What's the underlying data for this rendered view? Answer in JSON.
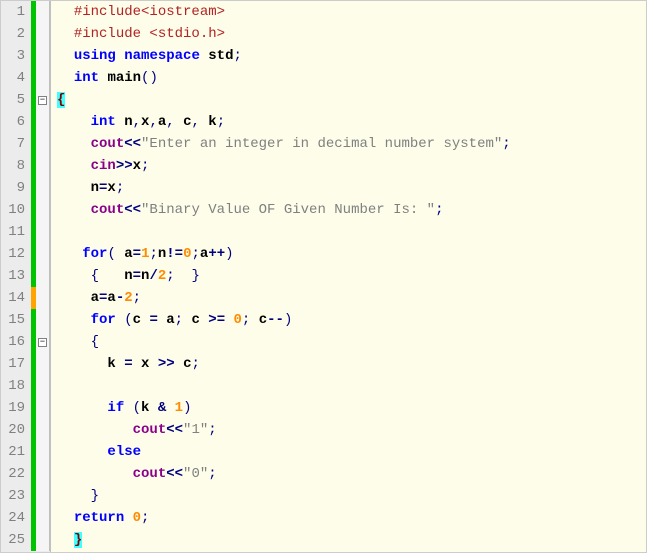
{
  "lines": [
    {
      "num": 1,
      "bar": "green",
      "fold": "",
      "tokens": [
        {
          "cls": "tok-plain",
          "t": "  "
        },
        {
          "cls": "tok-pre",
          "t": "#include<iostream>"
        }
      ]
    },
    {
      "num": 2,
      "bar": "green",
      "fold": "",
      "tokens": [
        {
          "cls": "tok-plain",
          "t": "  "
        },
        {
          "cls": "tok-pre",
          "t": "#include <stdio.h>"
        }
      ]
    },
    {
      "num": 3,
      "bar": "green",
      "fold": "",
      "tokens": [
        {
          "cls": "tok-plain",
          "t": "  "
        },
        {
          "cls": "tok-kw",
          "t": "using"
        },
        {
          "cls": "tok-plain",
          "t": " "
        },
        {
          "cls": "tok-kw",
          "t": "namespace"
        },
        {
          "cls": "tok-plain",
          "t": " "
        },
        {
          "cls": "tok-id",
          "t": "std"
        },
        {
          "cls": "tok-punc",
          "t": ";"
        }
      ]
    },
    {
      "num": 4,
      "bar": "green",
      "fold": "",
      "tokens": [
        {
          "cls": "tok-plain",
          "t": "  "
        },
        {
          "cls": "tok-kw",
          "t": "int"
        },
        {
          "cls": "tok-plain",
          "t": " "
        },
        {
          "cls": "tok-id",
          "t": "main"
        },
        {
          "cls": "tok-punc",
          "t": "()"
        }
      ]
    },
    {
      "num": 5,
      "bar": "green",
      "fold": "box",
      "tokens": [
        {
          "cls": "tok-br-hl",
          "t": "{"
        }
      ]
    },
    {
      "num": 6,
      "bar": "green",
      "fold": "",
      "tokens": [
        {
          "cls": "tok-plain",
          "t": "    "
        },
        {
          "cls": "tok-kw",
          "t": "int"
        },
        {
          "cls": "tok-plain",
          "t": " "
        },
        {
          "cls": "tok-id",
          "t": "n"
        },
        {
          "cls": "tok-punc",
          "t": ","
        },
        {
          "cls": "tok-id",
          "t": "x"
        },
        {
          "cls": "tok-punc",
          "t": ","
        },
        {
          "cls": "tok-id",
          "t": "a"
        },
        {
          "cls": "tok-punc",
          "t": ","
        },
        {
          "cls": "tok-plain",
          "t": " "
        },
        {
          "cls": "tok-id",
          "t": "c"
        },
        {
          "cls": "tok-punc",
          "t": ","
        },
        {
          "cls": "tok-plain",
          "t": " "
        },
        {
          "cls": "tok-id",
          "t": "k"
        },
        {
          "cls": "tok-punc",
          "t": ";"
        }
      ]
    },
    {
      "num": 7,
      "bar": "green",
      "fold": "",
      "tokens": [
        {
          "cls": "tok-plain",
          "t": "    "
        },
        {
          "cls": "tok-type",
          "t": "cout"
        },
        {
          "cls": "tok-op",
          "t": "<<"
        },
        {
          "cls": "tok-str",
          "t": "\"Enter an integer in decimal number system\""
        },
        {
          "cls": "tok-punc",
          "t": ";"
        }
      ]
    },
    {
      "num": 8,
      "bar": "green",
      "fold": "",
      "tokens": [
        {
          "cls": "tok-plain",
          "t": "    "
        },
        {
          "cls": "tok-type",
          "t": "cin"
        },
        {
          "cls": "tok-op",
          "t": ">>"
        },
        {
          "cls": "tok-id",
          "t": "x"
        },
        {
          "cls": "tok-punc",
          "t": ";"
        }
      ]
    },
    {
      "num": 9,
      "bar": "green",
      "fold": "",
      "tokens": [
        {
          "cls": "tok-plain",
          "t": "    "
        },
        {
          "cls": "tok-id",
          "t": "n"
        },
        {
          "cls": "tok-op",
          "t": "="
        },
        {
          "cls": "tok-id",
          "t": "x"
        },
        {
          "cls": "tok-punc",
          "t": ";"
        }
      ]
    },
    {
      "num": 10,
      "bar": "green",
      "fold": "",
      "tokens": [
        {
          "cls": "tok-plain",
          "t": "    "
        },
        {
          "cls": "tok-type",
          "t": "cout"
        },
        {
          "cls": "tok-op",
          "t": "<<"
        },
        {
          "cls": "tok-str",
          "t": "\"Binary Value OF Given Number Is: \""
        },
        {
          "cls": "tok-punc",
          "t": ";"
        }
      ]
    },
    {
      "num": 11,
      "bar": "green",
      "fold": "",
      "tokens": []
    },
    {
      "num": 12,
      "bar": "green",
      "fold": "",
      "tokens": [
        {
          "cls": "tok-plain",
          "t": "   "
        },
        {
          "cls": "tok-kw",
          "t": "for"
        },
        {
          "cls": "tok-punc",
          "t": "("
        },
        {
          "cls": "tok-plain",
          "t": " "
        },
        {
          "cls": "tok-id",
          "t": "a"
        },
        {
          "cls": "tok-op",
          "t": "="
        },
        {
          "cls": "tok-num",
          "t": "1"
        },
        {
          "cls": "tok-punc",
          "t": ";"
        },
        {
          "cls": "tok-id",
          "t": "n"
        },
        {
          "cls": "tok-op",
          "t": "!="
        },
        {
          "cls": "tok-num",
          "t": "0"
        },
        {
          "cls": "tok-punc",
          "t": ";"
        },
        {
          "cls": "tok-id",
          "t": "a"
        },
        {
          "cls": "tok-op",
          "t": "++"
        },
        {
          "cls": "tok-punc",
          "t": ")"
        }
      ]
    },
    {
      "num": 13,
      "bar": "green",
      "fold": "",
      "tokens": [
        {
          "cls": "tok-plain",
          "t": "    "
        },
        {
          "cls": "tok-punc",
          "t": "{"
        },
        {
          "cls": "tok-plain",
          "t": "   "
        },
        {
          "cls": "tok-id",
          "t": "n"
        },
        {
          "cls": "tok-op",
          "t": "="
        },
        {
          "cls": "tok-id",
          "t": "n"
        },
        {
          "cls": "tok-op",
          "t": "/"
        },
        {
          "cls": "tok-num",
          "t": "2"
        },
        {
          "cls": "tok-punc",
          "t": ";"
        },
        {
          "cls": "tok-plain",
          "t": "  "
        },
        {
          "cls": "tok-punc",
          "t": "}"
        }
      ]
    },
    {
      "num": 14,
      "bar": "orange",
      "fold": "",
      "tokens": [
        {
          "cls": "tok-plain",
          "t": "    "
        },
        {
          "cls": "tok-id",
          "t": "a"
        },
        {
          "cls": "tok-op",
          "t": "="
        },
        {
          "cls": "tok-id",
          "t": "a"
        },
        {
          "cls": "tok-op",
          "t": "-"
        },
        {
          "cls": "tok-num",
          "t": "2"
        },
        {
          "cls": "tok-punc",
          "t": ";"
        }
      ]
    },
    {
      "num": 15,
      "bar": "green",
      "fold": "",
      "tokens": [
        {
          "cls": "tok-plain",
          "t": "    "
        },
        {
          "cls": "tok-kw",
          "t": "for"
        },
        {
          "cls": "tok-plain",
          "t": " "
        },
        {
          "cls": "tok-punc",
          "t": "("
        },
        {
          "cls": "tok-id",
          "t": "c"
        },
        {
          "cls": "tok-plain",
          "t": " "
        },
        {
          "cls": "tok-op",
          "t": "="
        },
        {
          "cls": "tok-plain",
          "t": " "
        },
        {
          "cls": "tok-id",
          "t": "a"
        },
        {
          "cls": "tok-punc",
          "t": ";"
        },
        {
          "cls": "tok-plain",
          "t": " "
        },
        {
          "cls": "tok-id",
          "t": "c"
        },
        {
          "cls": "tok-plain",
          "t": " "
        },
        {
          "cls": "tok-op",
          "t": ">="
        },
        {
          "cls": "tok-plain",
          "t": " "
        },
        {
          "cls": "tok-num",
          "t": "0"
        },
        {
          "cls": "tok-punc",
          "t": ";"
        },
        {
          "cls": "tok-plain",
          "t": " "
        },
        {
          "cls": "tok-id",
          "t": "c"
        },
        {
          "cls": "tok-op",
          "t": "--"
        },
        {
          "cls": "tok-punc",
          "t": ")"
        }
      ]
    },
    {
      "num": 16,
      "bar": "green",
      "fold": "box",
      "tokens": [
        {
          "cls": "tok-plain",
          "t": "    "
        },
        {
          "cls": "tok-punc",
          "t": "{"
        }
      ]
    },
    {
      "num": 17,
      "bar": "green",
      "fold": "",
      "tokens": [
        {
          "cls": "tok-plain",
          "t": "      "
        },
        {
          "cls": "tok-id",
          "t": "k"
        },
        {
          "cls": "tok-plain",
          "t": " "
        },
        {
          "cls": "tok-op",
          "t": "="
        },
        {
          "cls": "tok-plain",
          "t": " "
        },
        {
          "cls": "tok-id",
          "t": "x"
        },
        {
          "cls": "tok-plain",
          "t": " "
        },
        {
          "cls": "tok-op",
          "t": ">>"
        },
        {
          "cls": "tok-plain",
          "t": " "
        },
        {
          "cls": "tok-id",
          "t": "c"
        },
        {
          "cls": "tok-punc",
          "t": ";"
        }
      ]
    },
    {
      "num": 18,
      "bar": "green",
      "fold": "",
      "tokens": []
    },
    {
      "num": 19,
      "bar": "green",
      "fold": "",
      "tokens": [
        {
          "cls": "tok-plain",
          "t": "      "
        },
        {
          "cls": "tok-kw",
          "t": "if"
        },
        {
          "cls": "tok-plain",
          "t": " "
        },
        {
          "cls": "tok-punc",
          "t": "("
        },
        {
          "cls": "tok-id",
          "t": "k"
        },
        {
          "cls": "tok-plain",
          "t": " "
        },
        {
          "cls": "tok-op",
          "t": "&"
        },
        {
          "cls": "tok-plain",
          "t": " "
        },
        {
          "cls": "tok-num",
          "t": "1"
        },
        {
          "cls": "tok-punc",
          "t": ")"
        }
      ]
    },
    {
      "num": 20,
      "bar": "green",
      "fold": "",
      "tokens": [
        {
          "cls": "tok-plain",
          "t": "         "
        },
        {
          "cls": "tok-type",
          "t": "cout"
        },
        {
          "cls": "tok-op",
          "t": "<<"
        },
        {
          "cls": "tok-str",
          "t": "\"1\""
        },
        {
          "cls": "tok-punc",
          "t": ";"
        }
      ]
    },
    {
      "num": 21,
      "bar": "green",
      "fold": "",
      "tokens": [
        {
          "cls": "tok-plain",
          "t": "      "
        },
        {
          "cls": "tok-kw",
          "t": "else"
        }
      ]
    },
    {
      "num": 22,
      "bar": "green",
      "fold": "",
      "tokens": [
        {
          "cls": "tok-plain",
          "t": "         "
        },
        {
          "cls": "tok-type",
          "t": "cout"
        },
        {
          "cls": "tok-op",
          "t": "<<"
        },
        {
          "cls": "tok-str",
          "t": "\"0\""
        },
        {
          "cls": "tok-punc",
          "t": ";"
        }
      ]
    },
    {
      "num": 23,
      "bar": "green",
      "fold": "",
      "tokens": [
        {
          "cls": "tok-plain",
          "t": "    "
        },
        {
          "cls": "tok-punc",
          "t": "}"
        }
      ]
    },
    {
      "num": 24,
      "bar": "green",
      "fold": "",
      "tokens": [
        {
          "cls": "tok-plain",
          "t": "  "
        },
        {
          "cls": "tok-kw",
          "t": "return"
        },
        {
          "cls": "tok-plain",
          "t": " "
        },
        {
          "cls": "tok-num",
          "t": "0"
        },
        {
          "cls": "tok-punc",
          "t": ";"
        }
      ]
    },
    {
      "num": 25,
      "bar": "green",
      "fold": "",
      "tokens": [
        {
          "cls": "tok-plain",
          "t": "  "
        },
        {
          "cls": "tok-br-hl",
          "t": "}"
        }
      ]
    }
  ],
  "fold_symbol": "−"
}
